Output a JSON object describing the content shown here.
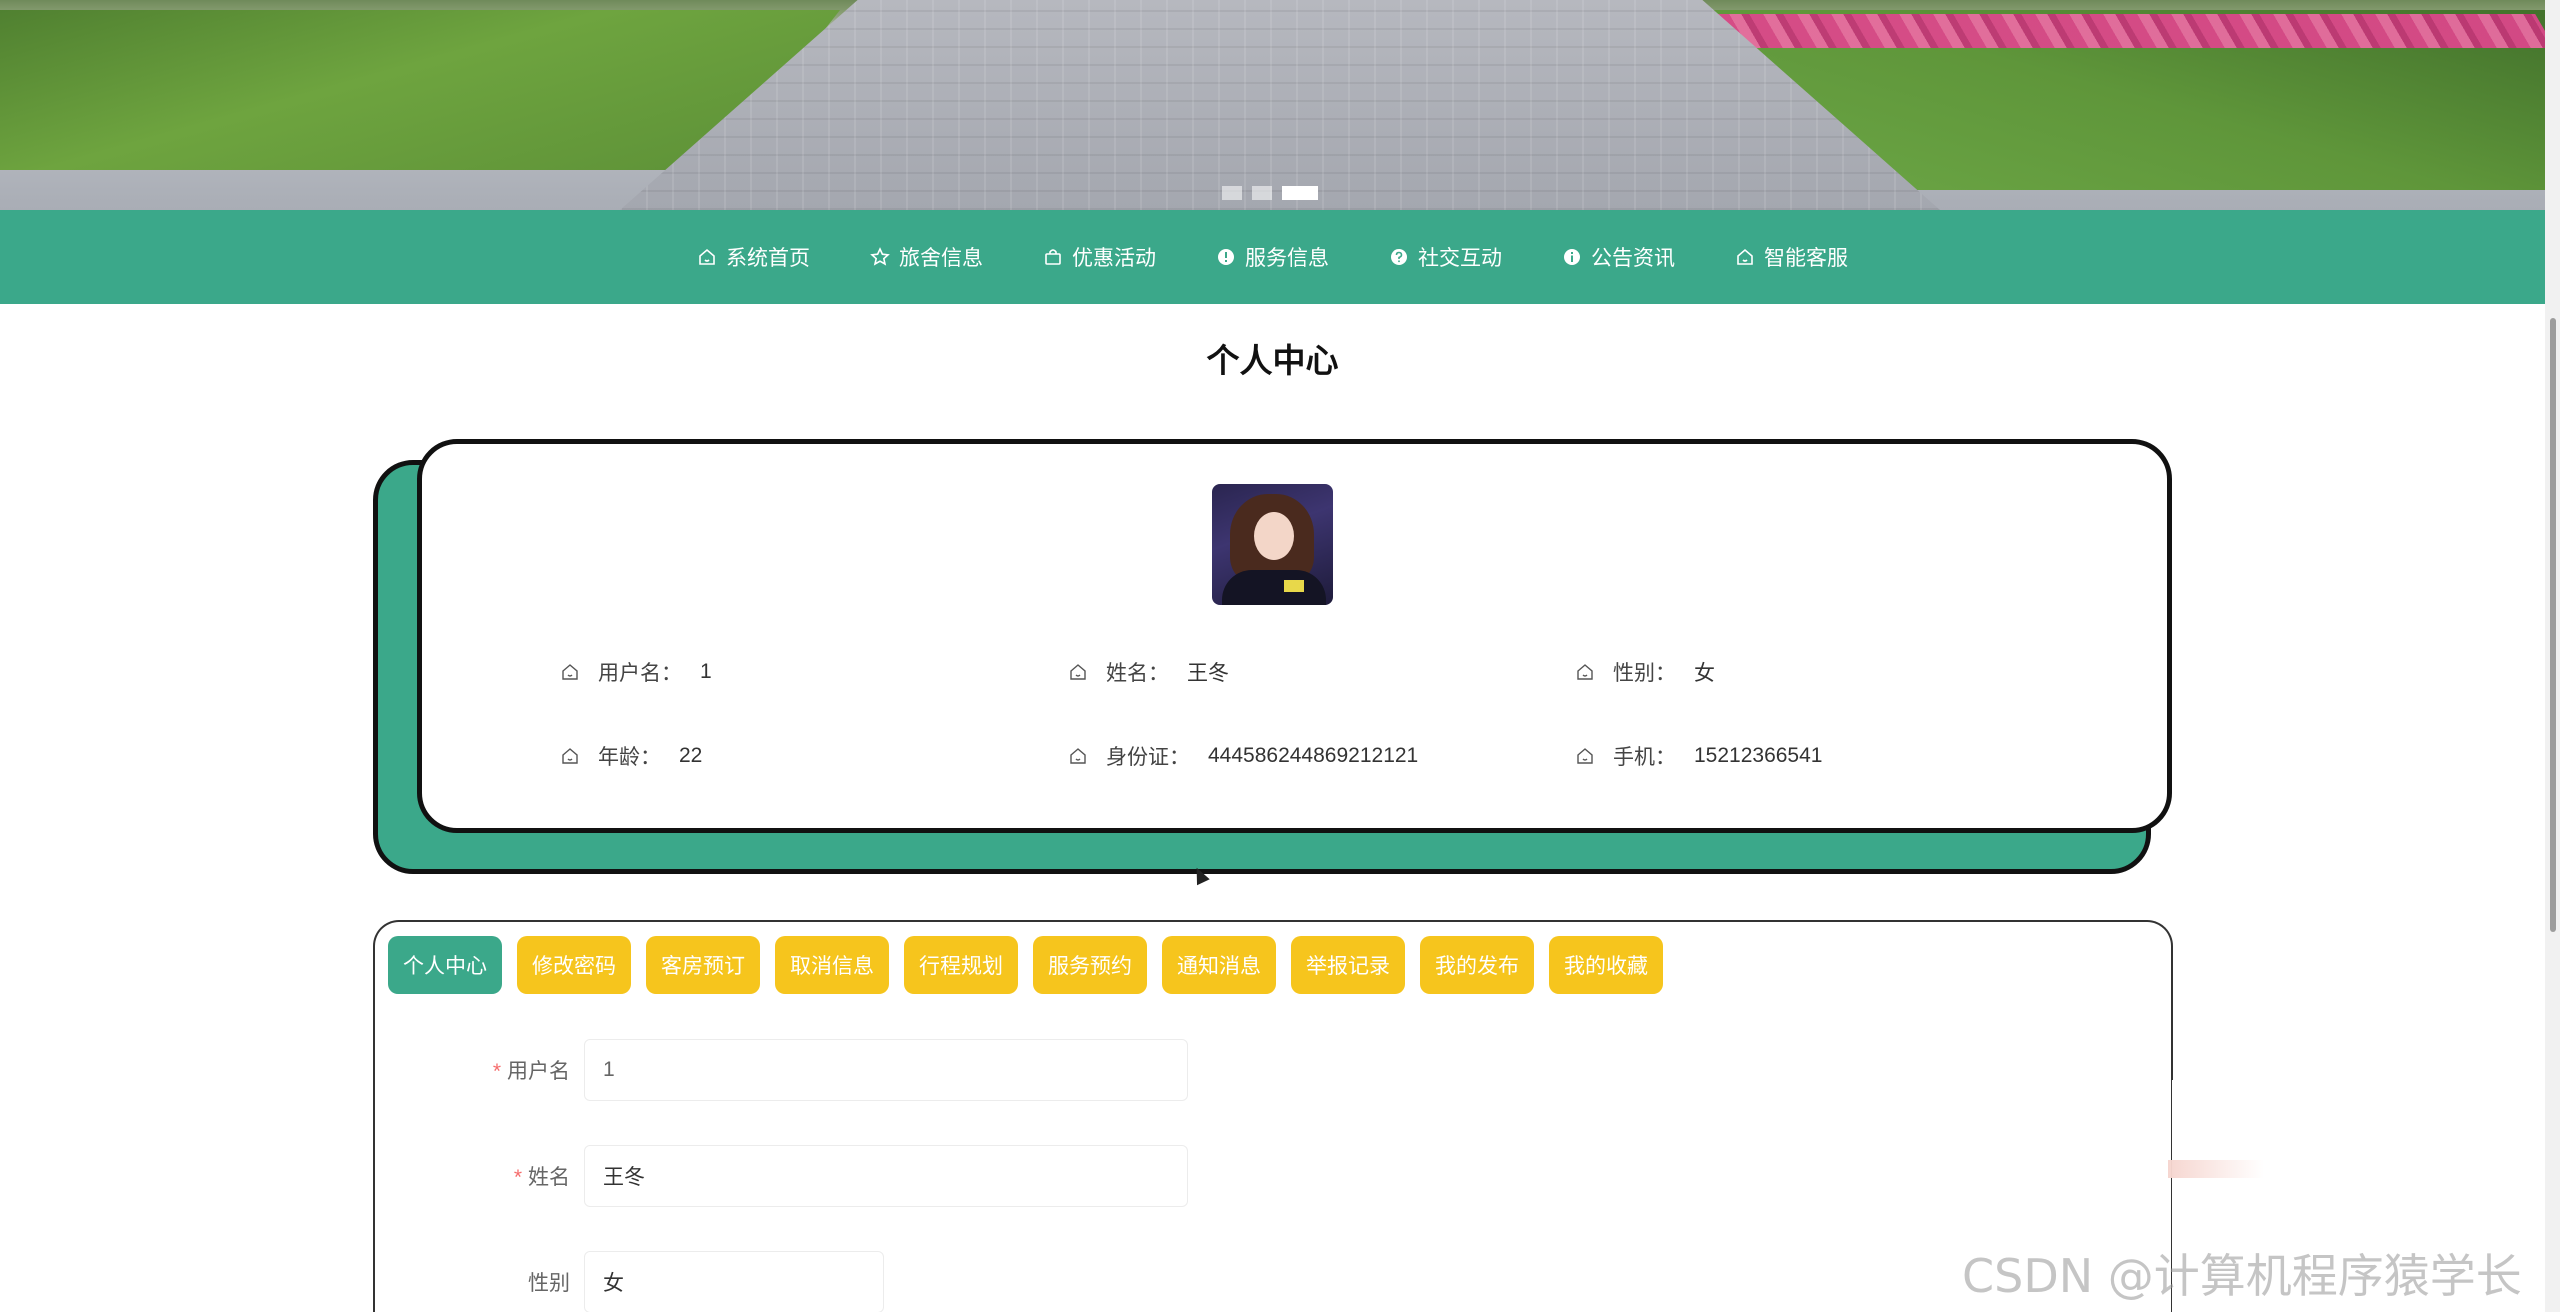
{
  "banner": {
    "slides": 3,
    "active_slide": 3
  },
  "nav": {
    "items": [
      {
        "label": "系统首页",
        "icon": "home-icon"
      },
      {
        "label": "旅舍信息",
        "icon": "star-icon"
      },
      {
        "label": "优惠活动",
        "icon": "bag-icon"
      },
      {
        "label": "服务信息",
        "icon": "alert-circle-icon"
      },
      {
        "label": "社交互动",
        "icon": "question-circle-icon"
      },
      {
        "label": "公告资讯",
        "icon": "info-circle-icon"
      },
      {
        "label": "智能客服",
        "icon": "home-icon"
      }
    ]
  },
  "page_title": "个人中心",
  "profile": {
    "username_label": "用户名：",
    "username": "1",
    "name_label": "姓名：",
    "name": "王冬",
    "gender_label": "性别：",
    "gender": "女",
    "age_label": "年龄：",
    "age": "22",
    "idcard_label": "身份证：",
    "idcard": "444586244869212121",
    "phone_label": "手机：",
    "phone": "15212366541"
  },
  "tabs": [
    {
      "label": "个人中心",
      "active": true
    },
    {
      "label": "修改密码"
    },
    {
      "label": "客房预订"
    },
    {
      "label": "取消信息"
    },
    {
      "label": "行程规划"
    },
    {
      "label": "服务预约"
    },
    {
      "label": "通知消息"
    },
    {
      "label": "举报记录"
    },
    {
      "label": "我的发布"
    },
    {
      "label": "我的收藏"
    }
  ],
  "form": {
    "required_mark": "*",
    "username_label": "用户名",
    "username_value": "1",
    "name_label": "姓名",
    "name_value": "王冬",
    "gender_label": "性别",
    "gender_value": "女"
  },
  "watermark": "CSDN @计算机程序猿学长",
  "colors": {
    "primary": "#3ba88a",
    "tab_yellow": "#f6c51d",
    "required": "#f56c6c"
  }
}
